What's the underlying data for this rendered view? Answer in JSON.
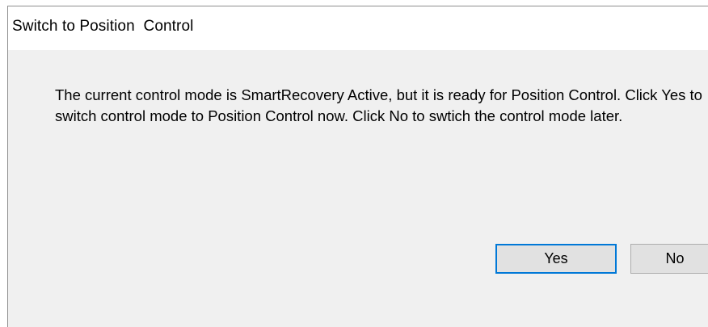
{
  "dialog": {
    "title": "Switch to Position  Control",
    "message": "The current control mode is SmartRecovery Active, but it is ready for Position Control. Click Yes to switch control mode to Position Control now. Click No to swtich the control mode later.",
    "buttons": {
      "yes_label": "Yes",
      "no_label": "No"
    },
    "colors": {
      "title_bar": "#ffffff",
      "body_background": "#f0f0f0",
      "button_face": "#e1e1e1",
      "default_button_focus": "#0078d7"
    }
  }
}
